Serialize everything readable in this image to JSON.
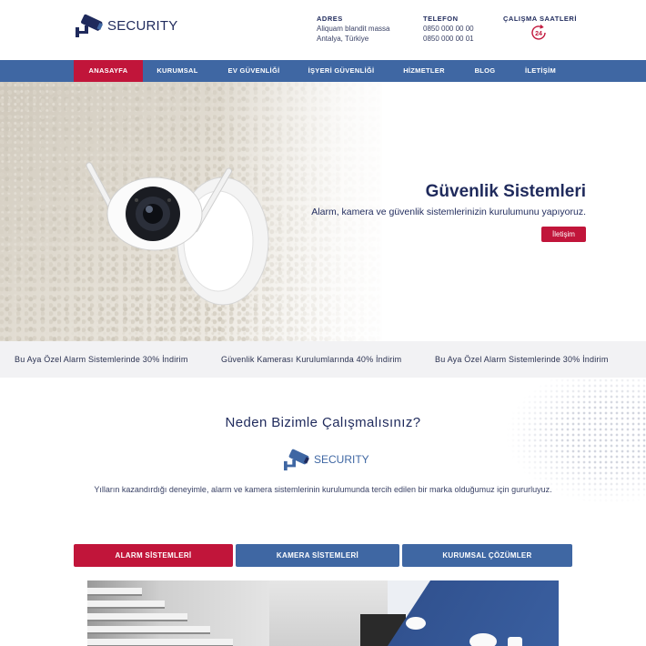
{
  "brand": {
    "name": "SECURITY"
  },
  "header": {
    "address": {
      "label": "ADRES",
      "line1": "Aliquam blandit massa",
      "line2": "Antalya, Türkiye"
    },
    "phone": {
      "label": "TELEFON",
      "line1": "0850 000 00 00",
      "line2": "0850 000 00 01"
    },
    "hours": {
      "label": "ÇALIŞMA SAATLERİ",
      "badge": "24"
    }
  },
  "nav": {
    "items": [
      {
        "label": "ANASAYFA",
        "active": true
      },
      {
        "label": "KURUMSAL",
        "active": false
      },
      {
        "label": "EV GÜVENLİĞİ",
        "active": false
      },
      {
        "label": "İŞYERİ GÜVENLİĞİ",
        "active": false
      },
      {
        "label": "HİZMETLER",
        "active": false
      },
      {
        "label": "BLOG",
        "active": false
      },
      {
        "label": "İLETİŞİM",
        "active": false
      }
    ]
  },
  "hero": {
    "title": "Güvenlik Sistemleri",
    "subtitle": "Alarm, kamera ve güvenlik sistemlerinizin kurulumunu yapıyoruz.",
    "button": "İletişim"
  },
  "ticker": {
    "items": [
      "Bu Aya Özel Alarm Sistemlerinde 30% İndirim",
      "Güvenlik Kamerası Kurulumlarında 40% İndirim",
      "Bu Aya Özel Alarm Sistemlerinde 30% İndirim"
    ]
  },
  "why": {
    "title": "Neden Bizimle Çalışmalısınız?",
    "brand": "SECURITY",
    "description": "Yılların kazandırdığı deneyimle, alarm ve kamera sistemlerinin kurulumunda tercih edilen bir marka olduğumuz için gururluyuz."
  },
  "tabs": {
    "items": [
      {
        "label": "ALARM SİSTEMLERİ",
        "active": true
      },
      {
        "label": "KAMERA SİSTEMLERİ",
        "active": false
      },
      {
        "label": "KURUMSAL ÇÖZÜMLER",
        "active": false
      }
    ]
  },
  "colors": {
    "primary": "#3f67a3",
    "accent": "#c1153a",
    "navy": "#1f2a5c"
  }
}
